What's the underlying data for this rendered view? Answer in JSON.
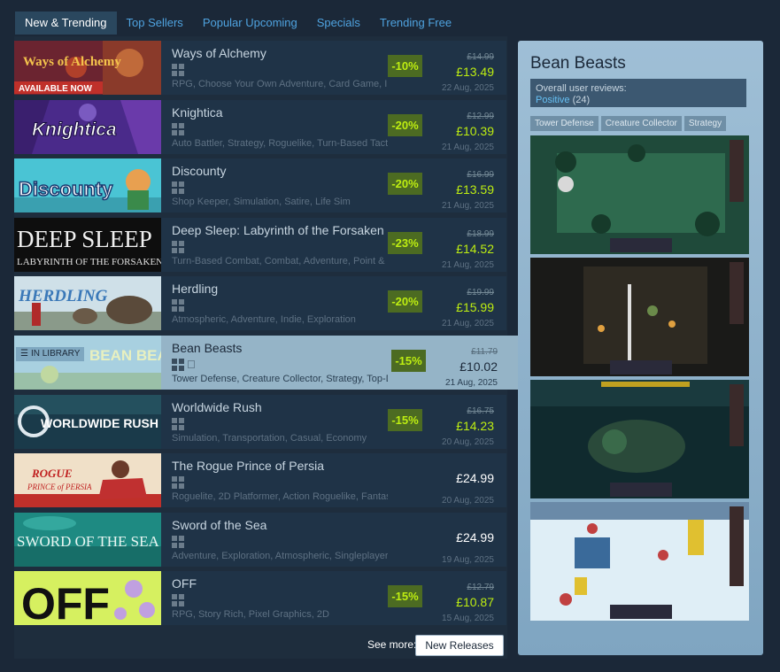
{
  "tabs": [
    "New & Trending",
    "Top Sellers",
    "Popular Upcoming",
    "Specials",
    "Trending Free"
  ],
  "games": [
    {
      "title": "Ways of Alchemy",
      "capsule_text": "Ways of Alchemy",
      "capsule_banner": "AVAILABLE NOW",
      "platforms": [
        "windows"
      ],
      "tags": "RPG, Choose Your Own Adventure, Card Game, In",
      "discount": "-10%",
      "original_price": "£14.99",
      "final_price": "£13.49",
      "date": "22 Aug, 2025"
    },
    {
      "title": "Knightica",
      "capsule_text": "Knightica",
      "platforms": [
        "windows"
      ],
      "tags": "Auto Battler, Strategy, Roguelike, Turn-Based Tactic",
      "discount": "-20%",
      "original_price": "£12.99",
      "final_price": "£10.39",
      "date": "21 Aug, 2025"
    },
    {
      "title": "Discounty",
      "capsule_text": "Discounty",
      "platforms": [
        "windows"
      ],
      "tags": "Shop Keeper, Simulation, Satire, Life Sim",
      "discount": "-20%",
      "original_price": "£16.99",
      "final_price": "£13.59",
      "date": "21 Aug, 2025"
    },
    {
      "title": "Deep Sleep: Labyrinth of the Forsaken",
      "capsule_text": "DEEP SLEEP",
      "capsule_sub": "LABYRINTH OF THE FORSAKEN",
      "platforms": [
        "windows"
      ],
      "tags": "Turn-Based Combat, Combat, Adventure, Point & C",
      "discount": "-23%",
      "original_price": "£18.99",
      "final_price": "£14.52",
      "date": "21 Aug, 2025"
    },
    {
      "title": "Herdling",
      "capsule_text": "HERDLING",
      "platforms": [
        "windows"
      ],
      "tags": "Atmospheric, Adventure, Indie, Exploration",
      "discount": "-20%",
      "original_price": "£19.99",
      "final_price": "£15.99",
      "date": "21 Aug, 2025"
    },
    {
      "title": "Bean Beasts",
      "capsule_text": "BEAN BEASTS",
      "in_library": "IN LIBRARY",
      "platforms": [
        "windows",
        "mac"
      ],
      "tags": "Tower Defense, Creature Collector, Strategy, Top-Do",
      "discount": "-15%",
      "original_price": "£11.79",
      "final_price": "£10.02",
      "date": "21 Aug, 2025"
    },
    {
      "title": "Worldwide Rush",
      "capsule_text": "WORLDWIDE RUSH",
      "platforms": [
        "windows"
      ],
      "tags": "Simulation, Transportation, Casual, Economy",
      "discount": "-15%",
      "original_price": "£16.75",
      "final_price": "£14.23",
      "date": "20 Aug, 2025"
    },
    {
      "title": "The Rogue Prince of Persia",
      "capsule_text": "ROGUE",
      "capsule_sub": "PRINCE of PERSIA",
      "platforms": [
        "windows"
      ],
      "tags": "Roguelite, 2D Platformer, Action Roguelike, Fantasy",
      "discount": "",
      "original_price": "",
      "final_price": "£24.99",
      "date": "20 Aug, 2025"
    },
    {
      "title": "Sword of the Sea",
      "capsule_text": "SWORD OF THE SEA",
      "platforms": [
        "windows"
      ],
      "tags": "Adventure, Exploration, Atmospheric, Singleplayer",
      "discount": "",
      "original_price": "",
      "final_price": "£24.99",
      "date": "19 Aug, 2025"
    },
    {
      "title": "OFF",
      "capsule_text": "OFF",
      "platforms": [
        "windows"
      ],
      "tags": "RPG, Story Rich, Pixel Graphics, 2D",
      "discount": "-15%",
      "original_price": "£12.79",
      "final_price": "£10.87",
      "date": "15 Aug, 2025"
    }
  ],
  "footer": {
    "see_more": "See more:",
    "button": "New Releases"
  },
  "preview": {
    "title": "Bean Beasts",
    "review_label": "Overall user reviews:",
    "review_value": "Positive",
    "review_count": "(24)",
    "tags": [
      "Tower Defense",
      "Creature Collector",
      "Strategy"
    ]
  },
  "colors": {
    "bg": "#1b2838",
    "accent": "#66c0f4",
    "discount_green": "#4c6b22",
    "discount_text": "#beee11"
  }
}
